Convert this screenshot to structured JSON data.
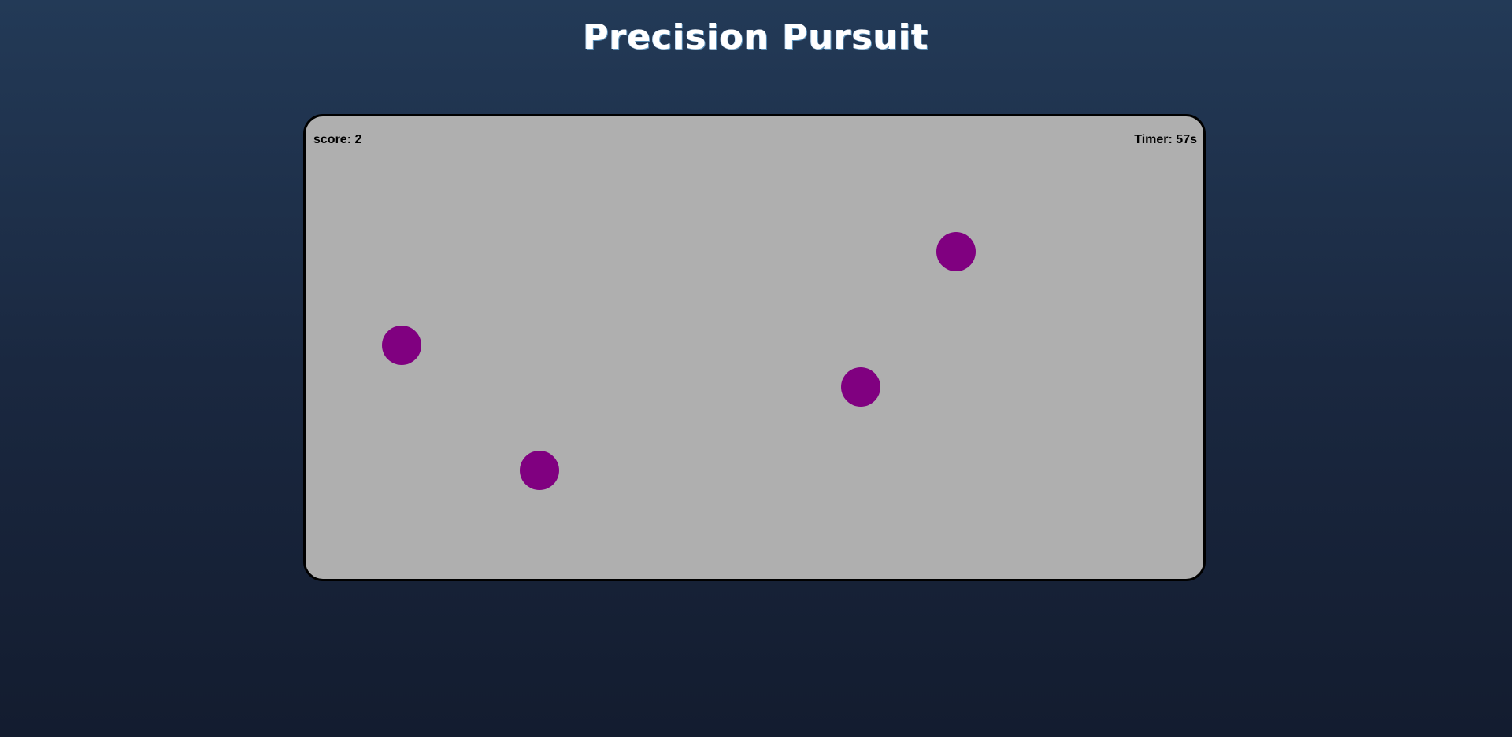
{
  "header": {
    "title": "Precision Pursuit"
  },
  "game": {
    "score_text": "score: 2",
    "timer_text": "Timer: 57s",
    "score": 2,
    "time_remaining_s": 57,
    "target_count": 4,
    "target_color": "#800080",
    "board_color": "#afafaf"
  }
}
